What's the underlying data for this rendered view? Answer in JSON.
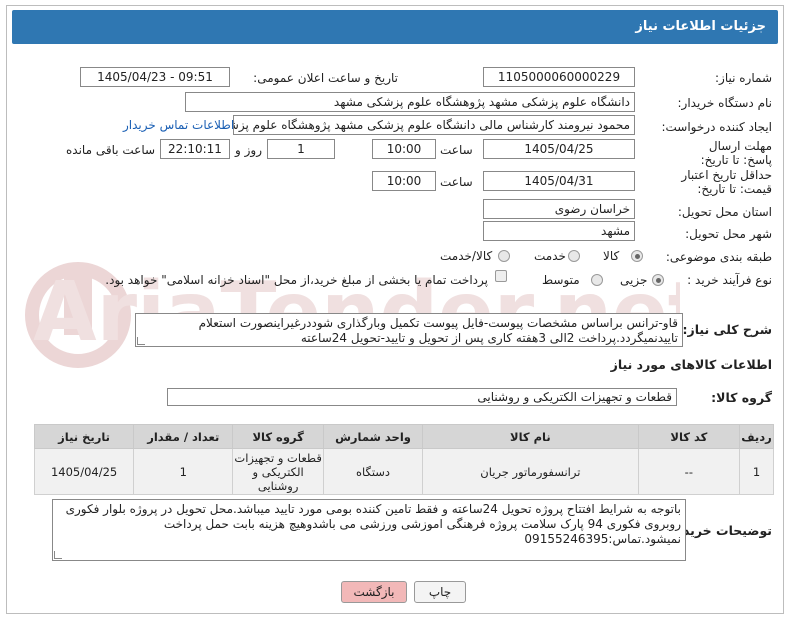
{
  "page": {
    "title": "جزئیات اطلاعات نیاز"
  },
  "form": {
    "need_number_label": "شماره نیاز:",
    "need_number": "1105000060000229",
    "announce_label": "تاریخ و ساعت اعلان عمومی:",
    "announce_value": "1405/04/23 - 09:51",
    "buyer_label": "نام دستگاه خریدار:",
    "buyer_value": "دانشگاه علوم پزشکی مشهد   پژوهشگاه علوم پزشکی مشهد",
    "creator_label": "ایجاد کننده درخواست:",
    "creator_value": "محمود نیرومند کارشناس مالی دانشگاه علوم پزشکی مشهد   پژوهشگاه علوم پزشکی مشهد",
    "contact_link": "اطلاعات تماس خریدار",
    "deadline_label": "مهلت ارسال پاسخ: تا تاریخ:",
    "deadline_date": "1405/04/25",
    "time_label": "ساعت",
    "deadline_time": "10:00",
    "days_value": "1",
    "days_label": "روز و",
    "remaining_value": "22:10:11",
    "remaining_label": "ساعت باقی مانده",
    "validity_label": "حداقل تاریخ اعتبار قیمت: تا تاریخ:",
    "validity_date": "1405/04/31",
    "validity_time": "10:00",
    "province_label": "استان محل تحویل:",
    "province_value": "خراسان رضوی",
    "city_label": "شهر محل تحویل:",
    "city_value": "مشهد",
    "category_label": "طبقه بندی موضوعی:",
    "category_options": [
      "کالا",
      "خدمت",
      "کالا/خدمت"
    ],
    "purchase_label": "نوع فرآیند خرید :",
    "purchase_options": [
      "جزیی",
      "متوسط"
    ],
    "purchase_note": "پرداخت تمام یا بخشی از مبلغ خرید،از محل \"اسناد خزانه اسلامی\" خواهد بود."
  },
  "summary": {
    "label": "شرح کلی نیاز:",
    "line1": "قاو-ترانس براساس مشخصات پیوست-فایل پیوست تکمیل وبارگذاری شوددرغیراینصورت استعلام",
    "line2": "تاییدنمیگردد.پرداخت 2الی 3هفته کاری پس از تحویل و تایید-تحویل 24ساعته"
  },
  "goods": {
    "section_title": "اطلاعات کالاهای مورد نیاز",
    "group_label": "گروه کالا:",
    "group_value": "قطعات و تجهیزات الکتریکی و روشنایی",
    "columns": [
      "ردیف",
      "کد کالا",
      "نام کالا",
      "واحد شمارش",
      "گروه کالا",
      "تعداد / مقدار",
      "تاریخ نیاز"
    ],
    "rows": [
      {
        "row": "1",
        "code": "--",
        "name": "ترانسفورماتور جریان",
        "unit": "دستگاه",
        "group_line1": "قطعات و تجهیزات",
        "group_line2": "الکتریکی و",
        "group_line3": "روشنایی",
        "qty": "1",
        "date": "1405/04/25"
      }
    ]
  },
  "notes": {
    "label": "توضیحات خریدار:",
    "line1": "باتوجه به شرایط افتتاح پروژه تحویل 24ساعته و فقط تامین کننده بومی مورد تایید میباشد.محل تحویل در پروژه بلوار فکوری",
    "line2": "روبروی فکوری 94 پارک سلامت پروژه فرهنگی اموزشی ورزشی می باشدوهیچ هزینه بابت حمل  پرداخت",
    "line3": "نمیشود.تماس:09155246395"
  },
  "buttons": {
    "print": "چاپ",
    "back": "بازگشت"
  },
  "watermark": {
    "text": "AriaTender.net"
  },
  "colors": {
    "header": "#2f77b2",
    "link": "#1a5fb4",
    "back_button": "#f2b8b8",
    "watermark": "#e9d3d3"
  }
}
